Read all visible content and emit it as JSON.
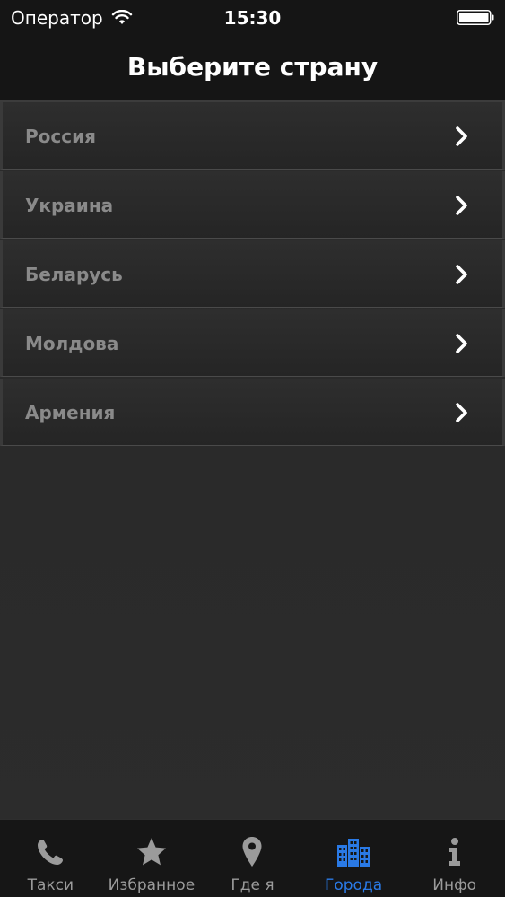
{
  "status_bar": {
    "carrier": "Оператор",
    "time": "15:30",
    "wifi_icon": "wifi-icon",
    "battery_icon": "battery-icon"
  },
  "nav": {
    "title": "Выберите страну"
  },
  "countries": [
    {
      "label": "Россия"
    },
    {
      "label": "Украина"
    },
    {
      "label": "Беларусь"
    },
    {
      "label": "Молдова"
    },
    {
      "label": "Армения"
    }
  ],
  "tabs": [
    {
      "label": "Такси",
      "icon": "phone-icon",
      "active": false
    },
    {
      "label": "Избранное",
      "icon": "star-icon",
      "active": false
    },
    {
      "label": "Где я",
      "icon": "location-pin-icon",
      "active": false
    },
    {
      "label": "Города",
      "icon": "city-buildings-icon",
      "active": true
    },
    {
      "label": "Инфо",
      "icon": "info-icon",
      "active": false
    }
  ],
  "colors": {
    "accent": "#2a7ae6",
    "inactive_tab": "#9b9b9b",
    "item_text": "#8a8a8a",
    "bar_background": "#151515"
  }
}
